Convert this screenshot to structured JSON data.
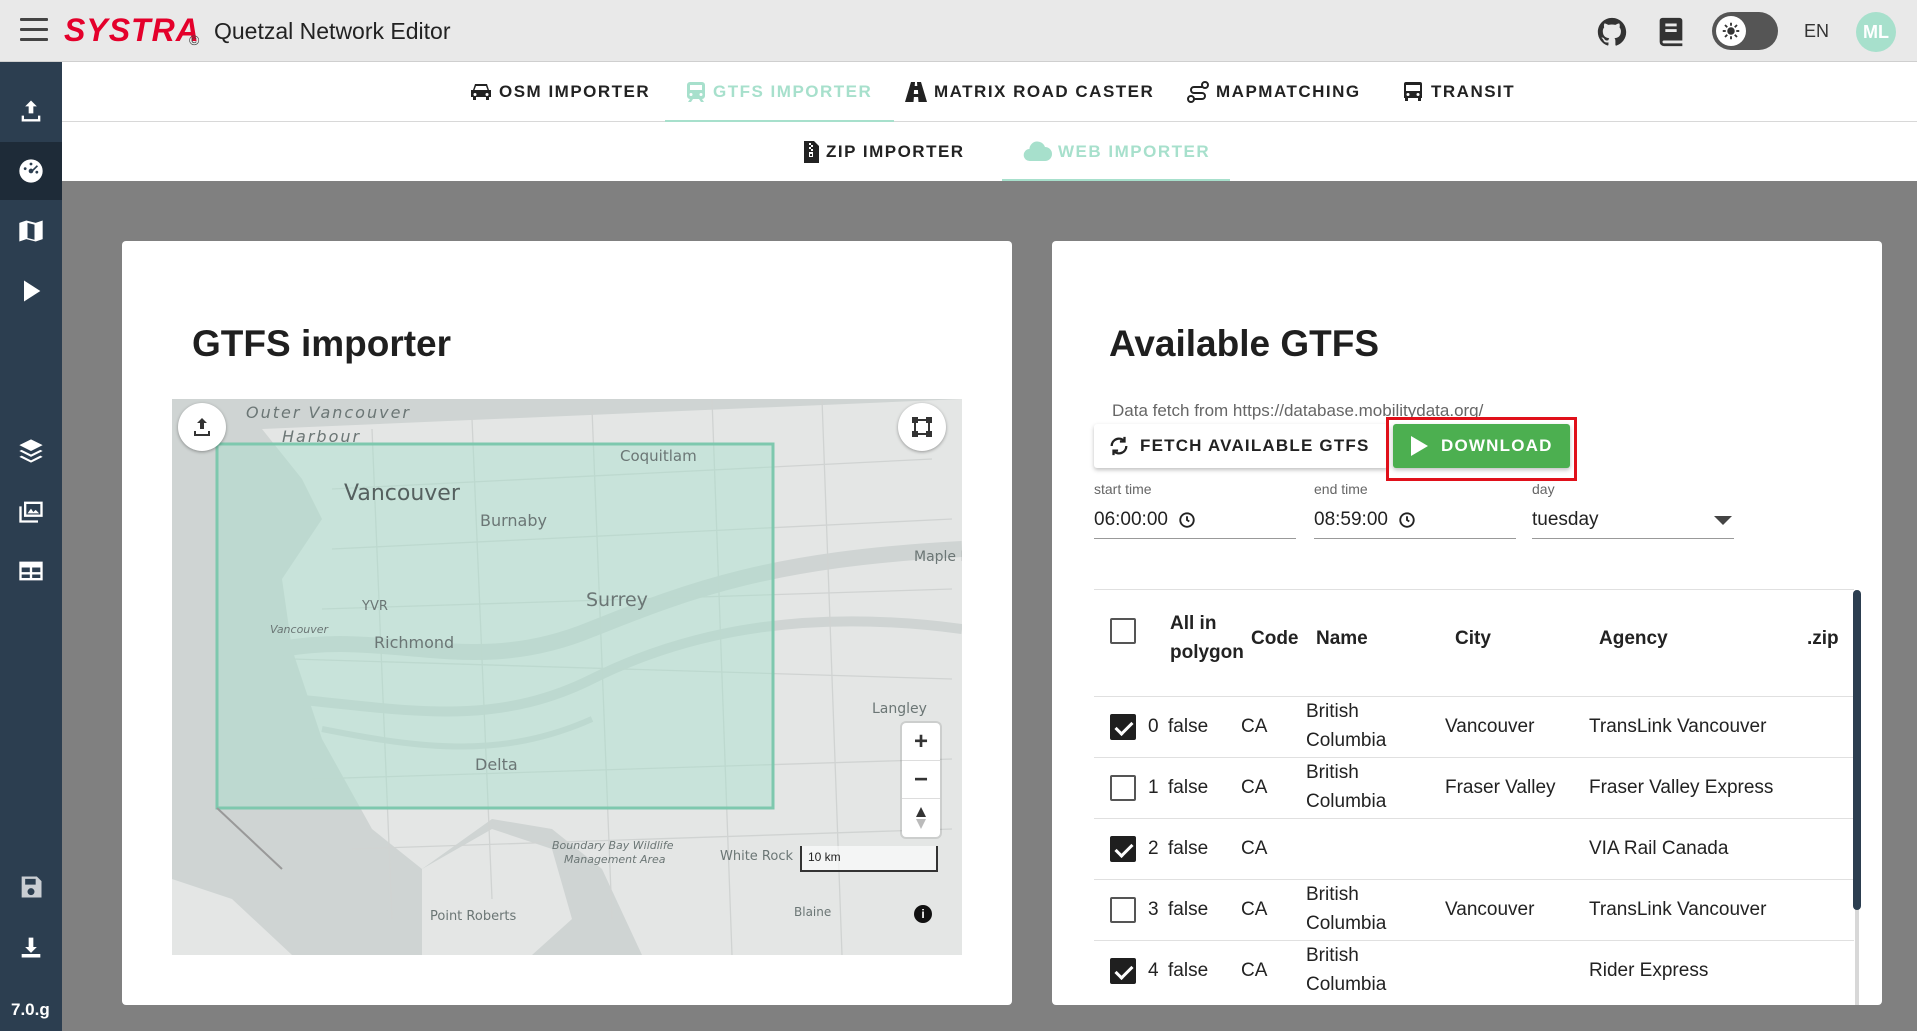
{
  "app": {
    "brand": "SYSTRA",
    "brand_mark": "©",
    "title": "Quetzal Network Editor",
    "language": "EN",
    "avatar_initials": "ML",
    "version": "7.0.g"
  },
  "main_tabs": [
    {
      "label": "OSM IMPORTER",
      "icon": "car-icon",
      "active": false
    },
    {
      "label": "GTFS IMPORTER",
      "icon": "train-icon",
      "active": true
    },
    {
      "label": "MATRIX ROAD CASTER",
      "icon": "road-icon",
      "active": false
    },
    {
      "label": "MAPMATCHING",
      "icon": "route-icon",
      "active": false
    },
    {
      "label": "TRANSIT",
      "icon": "bus-icon",
      "active": false
    }
  ],
  "sub_tabs": [
    {
      "label": "ZIP IMPORTER",
      "icon": "zip-file-icon",
      "active": false
    },
    {
      "label": "WEB IMPORTER",
      "icon": "cloud-icon",
      "active": true
    }
  ],
  "left_card": {
    "title": "GTFS importer",
    "map": {
      "labels": [
        "Outer Vancouver",
        "Harbour",
        "Coquitlam",
        "Vancouver",
        "Burnaby",
        "Maple R",
        "YVR",
        "Surrey",
        "Vancouver",
        "Richmond",
        "Langley",
        "Delta",
        "Boundary Bay Wildlife",
        "Management Area",
        "White Rock",
        "Point Roberts",
        "Blaine"
      ],
      "scale_label": "10 km",
      "info": "i"
    }
  },
  "right_card": {
    "title": "Available GTFS",
    "fetch_note": "Data fetch from https://database.mobilitydata.org/",
    "fetch_button": "FETCH AVAILABLE GTFS",
    "download_button": "DOWNLOAD",
    "start_time": {
      "label": "start time",
      "value": "06:00:00"
    },
    "end_time": {
      "label": "end time",
      "value": "08:59:00"
    },
    "day": {
      "label": "day",
      "value": "tuesday"
    },
    "table": {
      "headers": {
        "all_in_polygon_line1": "All in",
        "all_in_polygon_line2": "polygon",
        "code": "Code",
        "name": "Name",
        "city": "City",
        "agency": "Agency",
        "zip": ".zip"
      },
      "rows": [
        {
          "checked": true,
          "index": "0",
          "in_polygon": "false",
          "code": "CA",
          "name_line1": "British",
          "name_line2": "Columbia",
          "city": "Vancouver",
          "agency": "TransLink Vancouver"
        },
        {
          "checked": false,
          "index": "1",
          "in_polygon": "false",
          "code": "CA",
          "name_line1": "British",
          "name_line2": "Columbia",
          "city": "Fraser Valley",
          "agency": "Fraser Valley Express"
        },
        {
          "checked": true,
          "index": "2",
          "in_polygon": "false",
          "code": "CA",
          "name_line1": "",
          "name_line2": "",
          "city": "",
          "agency": "VIA Rail Canada"
        },
        {
          "checked": false,
          "index": "3",
          "in_polygon": "false",
          "code": "CA",
          "name_line1": "British",
          "name_line2": "Columbia",
          "city": "Vancouver",
          "agency": "TransLink Vancouver"
        },
        {
          "checked": true,
          "index": "4",
          "in_polygon": "false",
          "code": "CA",
          "name_line1": "British",
          "name_line2": "Columbia",
          "city": "",
          "agency": "Rider Express"
        }
      ]
    }
  },
  "colors": {
    "brand_red": "#e4002b",
    "accent_mint": "#a7e0cc",
    "sidebar": "#2c3e50",
    "download_green": "#4caf50",
    "highlight_red": "#e0101a"
  }
}
